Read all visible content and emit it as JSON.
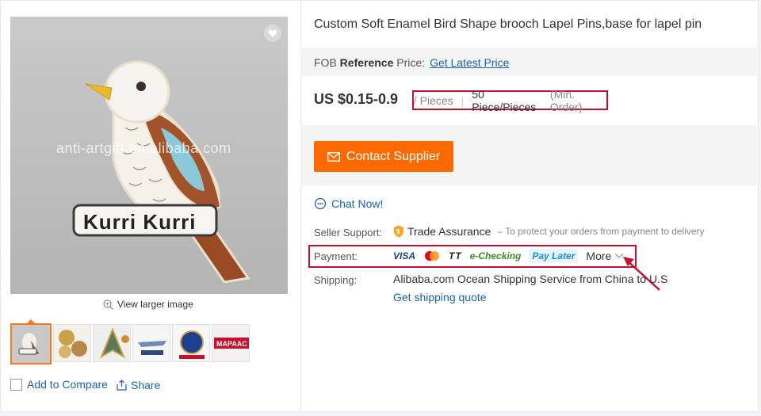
{
  "product": {
    "title": "Custom Soft Enamel Bird Shape brooch Lapel Pins,base for lapel pin",
    "image_watermark": "anti-artgift.en.alibaba.com",
    "pin_text": "Kurri Kurri",
    "view_larger": "View larger image",
    "thumbnails": [
      "bird pin",
      "round coins",
      "arrowhead pin",
      "small pin",
      "plane badge",
      "crest pin",
      "MAPAAC pin"
    ],
    "add_to_compare": "Add to Compare",
    "share": "Share"
  },
  "pricing": {
    "fob_prefix": "FOB ",
    "fob_bold": "Reference",
    "fob_suffix": " Price:",
    "fob_link": "Get Latest Price",
    "price": "US $0.15-0.9",
    "slash": "/",
    "unit": "Pieces",
    "moq": "50 Piece/Pieces",
    "min_order": "(Min. Order)"
  },
  "actions": {
    "contact_supplier": "Contact Supplier",
    "chat_now": "Chat Now!"
  },
  "seller_support": {
    "label": "Seller Support:",
    "value": "Trade Assurance",
    "note": "– To protect your orders from payment to delivery"
  },
  "payment": {
    "label": "Payment:",
    "methods": [
      "VISA",
      "mastercard-icon",
      "TT",
      "e-Checking",
      "Pay Later"
    ],
    "more": "More"
  },
  "shipping": {
    "label": "Shipping:",
    "value": "Alibaba.com Ocean Shipping Service from China to U.S",
    "quote_link": "Get shipping quote"
  },
  "colors": {
    "accent": "#ff6a00",
    "link": "#1a62b7",
    "highlight": "#c8102e"
  }
}
